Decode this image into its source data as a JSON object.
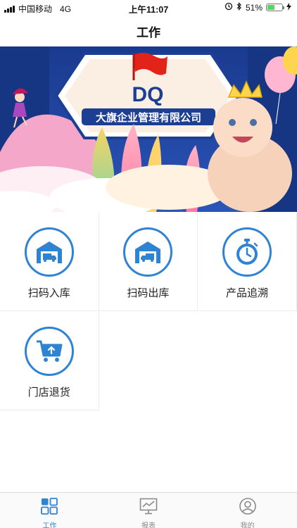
{
  "status_bar": {
    "carrier": "中国移动",
    "network": "4G",
    "time": "上午11:07",
    "battery_percent": "51%",
    "battery_level": 0.51
  },
  "nav": {
    "title": "工作"
  },
  "banner": {
    "logo_text": "DQ",
    "company_name": "大旗企业管理有限公司"
  },
  "actions": [
    {
      "label": "扫码入库",
      "icon": "warehouse-truck-in-icon"
    },
    {
      "label": "扫码出库",
      "icon": "warehouse-truck-out-icon"
    },
    {
      "label": "产品追溯",
      "icon": "stopwatch-icon"
    },
    {
      "label": "门店退货",
      "icon": "cart-return-icon"
    }
  ],
  "tabs": [
    {
      "label": "工作",
      "icon": "grid-icon",
      "active": true
    },
    {
      "label": "报表",
      "icon": "chart-icon",
      "active": false
    },
    {
      "label": "我的",
      "icon": "user-icon",
      "active": false
    }
  ],
  "colors": {
    "accent": "#2f83d3",
    "banner_bg": "#1c3f94",
    "battery": "#4cd964"
  }
}
